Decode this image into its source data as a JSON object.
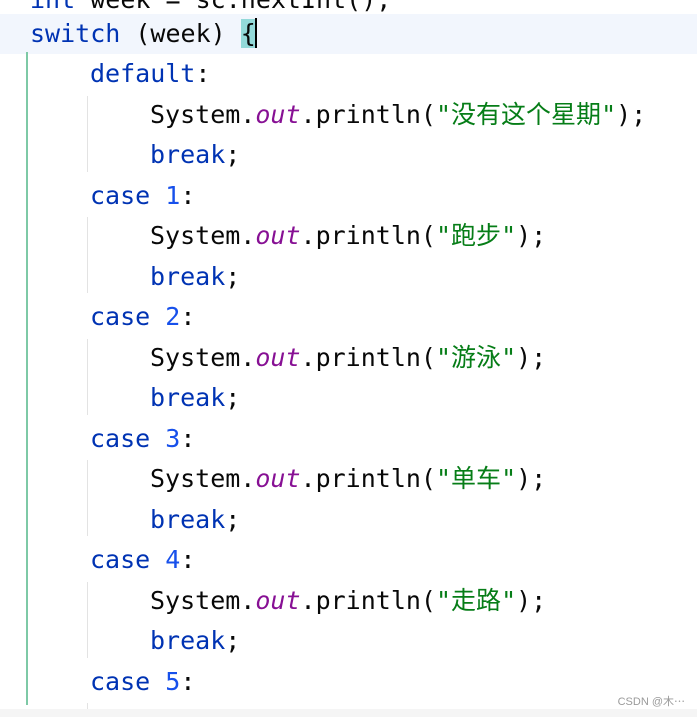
{
  "code": {
    "line0": [
      "int",
      "week",
      "=",
      "sc.nextInt();"
    ],
    "switch_kw": "switch",
    "switch_rest": " (week) ",
    "open_brace": "{",
    "default_kw": "default",
    "colon": ":",
    "system": "System.",
    "out": "out",
    "println": ".println(",
    "quote_open": "\"",
    "quote_close": "\"",
    "call_end": ");",
    "break_kw": "break",
    "semicolon": ";",
    "case_kw": "case",
    "default_msg": "没有这个星期",
    "cases": [
      {
        "num": "1",
        "msg": "跑步"
      },
      {
        "num": "2",
        "msg": "游泳"
      },
      {
        "num": "3",
        "msg": "单车"
      },
      {
        "num": "4",
        "msg": "走路"
      },
      {
        "num": "5"
      }
    ]
  },
  "colors": {
    "keyword": "#0033b3",
    "number": "#1750eb",
    "string": "#067d17",
    "field": "#871094",
    "current_line": "#f2f6fd",
    "brace_match": "#93d9d9",
    "indent_guide": "#7ec9a6"
  },
  "watermark": "CSDN @木⋯"
}
